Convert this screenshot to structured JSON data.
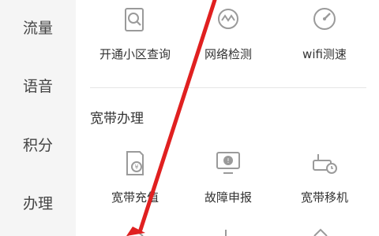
{
  "sidebar": {
    "items": [
      {
        "label": "流量"
      },
      {
        "label": "语音"
      },
      {
        "label": "积分"
      },
      {
        "label": "办理"
      }
    ]
  },
  "main": {
    "top_row": [
      {
        "label": "开通小区查询",
        "icon": "search-document-icon"
      },
      {
        "label": "网络检测",
        "icon": "network-check-icon"
      },
      {
        "label": "wifi测速",
        "icon": "speed-gauge-icon"
      }
    ],
    "section": {
      "title": "宽带办理",
      "items": [
        {
          "label": "宽带充值",
          "icon": "recharge-bill-icon"
        },
        {
          "label": "故障申报",
          "icon": "fault-report-icon"
        },
        {
          "label": "宽带移机",
          "icon": "router-move-icon"
        }
      ]
    }
  },
  "colors": {
    "icon_stroke": "#9a9a9a",
    "annotation_red": "#e02020",
    "sidebar_bg": "#f5f5f5"
  }
}
